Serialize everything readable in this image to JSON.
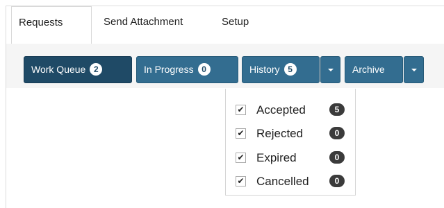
{
  "tabs": [
    {
      "label": "Requests"
    },
    {
      "label": "Send Attachment"
    },
    {
      "label": "Setup"
    }
  ],
  "toolbar": {
    "work_queue": {
      "label": "Work Queue",
      "count": "2"
    },
    "in_progress": {
      "label": "In Progress",
      "count": "0"
    },
    "history": {
      "label": "History",
      "count": "5"
    },
    "archive": {
      "label": "Archive"
    }
  },
  "history_menu": {
    "items": [
      {
        "label": "Accepted",
        "count": "5",
        "checked": true
      },
      {
        "label": "Rejected",
        "count": "0",
        "checked": true
      },
      {
        "label": "Expired",
        "count": "0",
        "checked": true
      },
      {
        "label": "Cancelled",
        "count": "0",
        "checked": true
      }
    ]
  },
  "colors": {
    "button_primary": "#336d90",
    "button_active": "#1f4a66",
    "badge_dark": "#3b3b3b"
  },
  "icons": {
    "checkbox_checked": "✔",
    "caret": "chevron-down-icon"
  }
}
